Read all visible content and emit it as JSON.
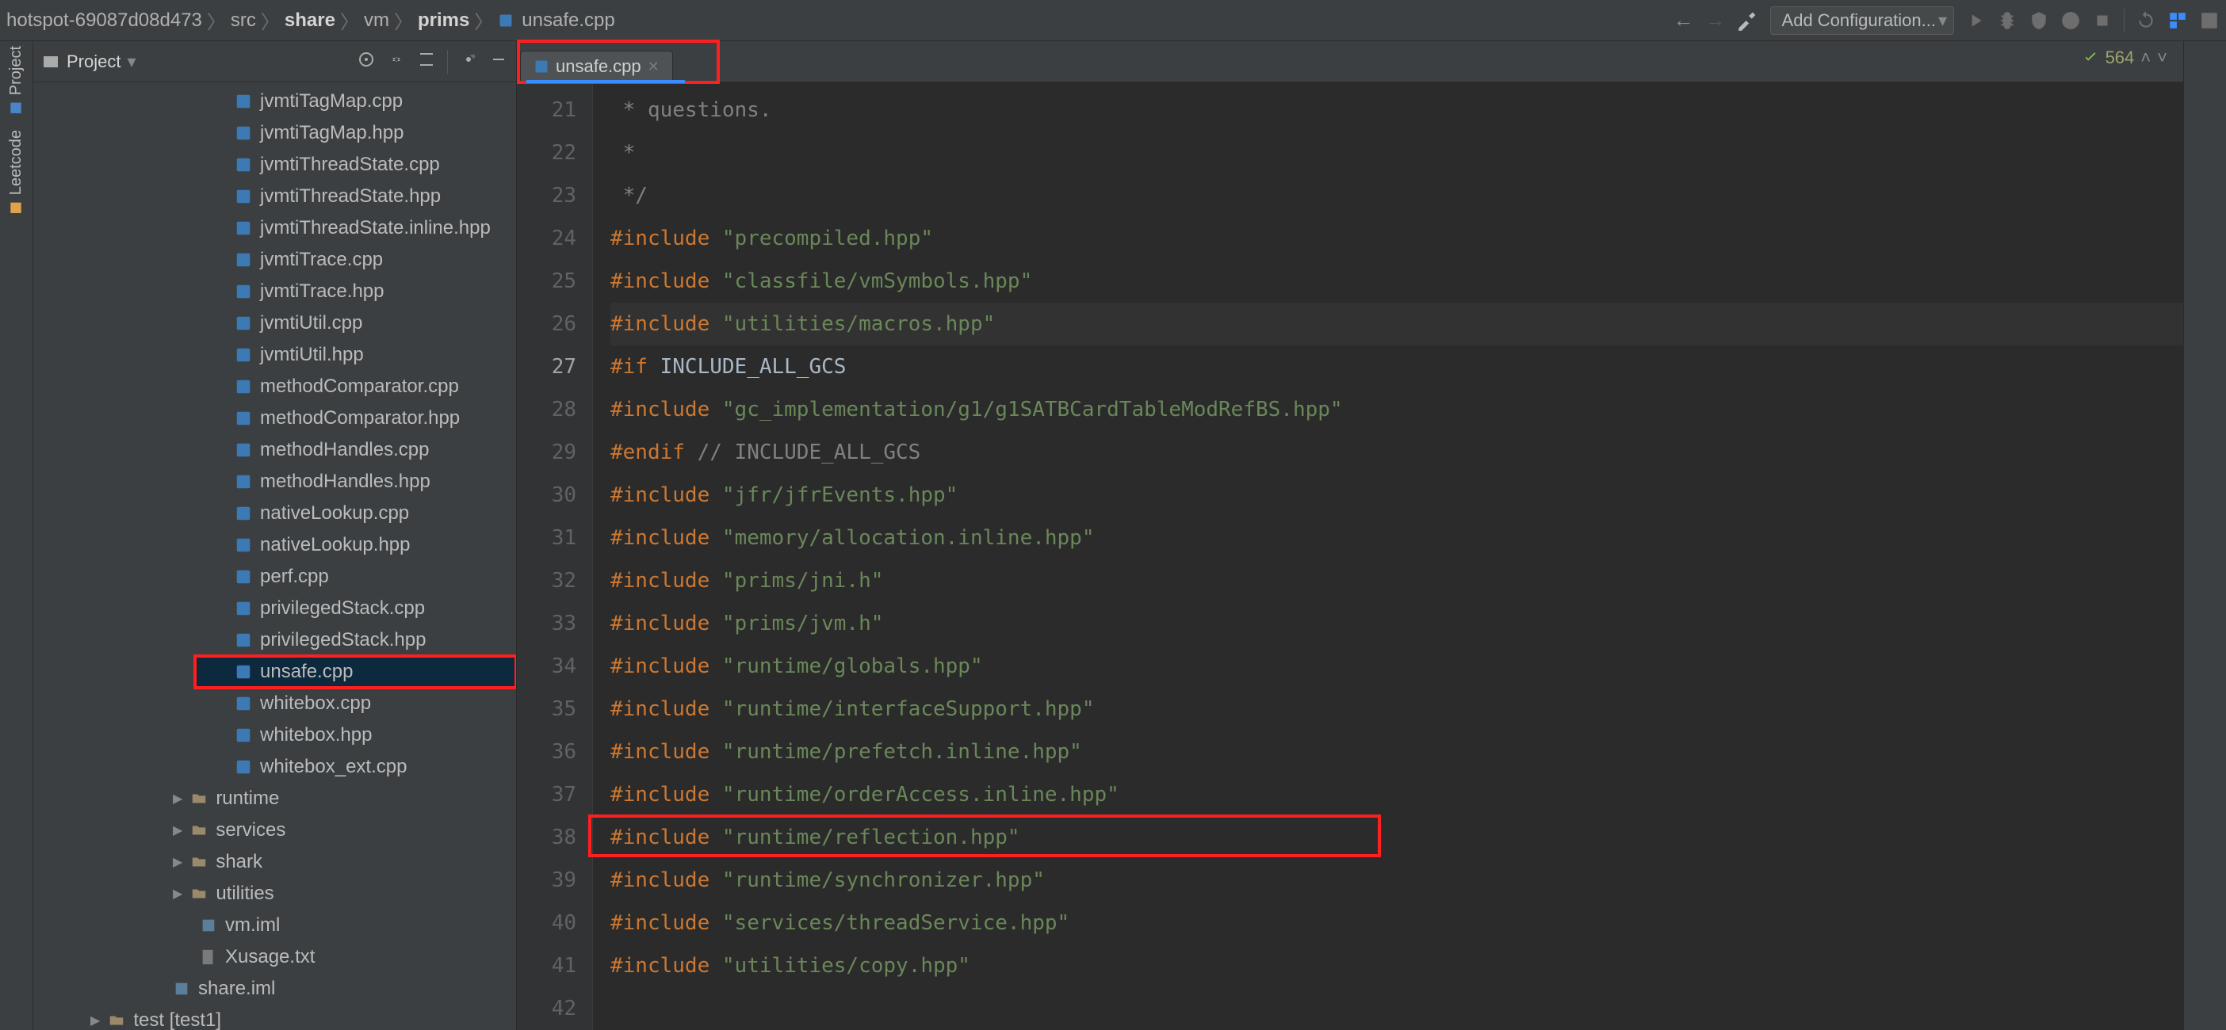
{
  "breadcrumb": {
    "segments": [
      "hotspot-69087d08d473",
      "src",
      "share",
      "vm",
      "prims",
      "unsafe.cpp"
    ],
    "bold_indices": [
      2,
      4
    ]
  },
  "toolbar": {
    "add_config_label": "Add Configuration..."
  },
  "leftrail": {
    "items": [
      "Project",
      "Leetcode"
    ]
  },
  "project_panel": {
    "title": "Project",
    "tree": [
      {
        "t": "file",
        "label": "jvmtiTagMap.cpp"
      },
      {
        "t": "file",
        "label": "jvmtiTagMap.hpp"
      },
      {
        "t": "file",
        "label": "jvmtiThreadState.cpp"
      },
      {
        "t": "file",
        "label": "jvmtiThreadState.hpp"
      },
      {
        "t": "file",
        "label": "jvmtiThreadState.inline.hpp"
      },
      {
        "t": "file",
        "label": "jvmtiTrace.cpp"
      },
      {
        "t": "file",
        "label": "jvmtiTrace.hpp"
      },
      {
        "t": "file",
        "label": "jvmtiUtil.cpp"
      },
      {
        "t": "file",
        "label": "jvmtiUtil.hpp"
      },
      {
        "t": "file",
        "label": "methodComparator.cpp"
      },
      {
        "t": "file",
        "label": "methodComparator.hpp"
      },
      {
        "t": "file",
        "label": "methodHandles.cpp"
      },
      {
        "t": "file",
        "label": "methodHandles.hpp"
      },
      {
        "t": "file",
        "label": "nativeLookup.cpp"
      },
      {
        "t": "file",
        "label": "nativeLookup.hpp"
      },
      {
        "t": "file",
        "label": "perf.cpp"
      },
      {
        "t": "file",
        "label": "privilegedStack.cpp"
      },
      {
        "t": "file",
        "label": "privilegedStack.hpp"
      },
      {
        "t": "file",
        "label": "unsafe.cpp",
        "selected": true,
        "highlighted": true
      },
      {
        "t": "file",
        "label": "whitebox.cpp"
      },
      {
        "t": "file",
        "label": "whitebox.hpp"
      },
      {
        "t": "file",
        "label": "whitebox_ext.cpp"
      },
      {
        "t": "folder0",
        "label": "runtime",
        "chev": "▶"
      },
      {
        "t": "folder0",
        "label": "services",
        "chev": "▶"
      },
      {
        "t": "folder0",
        "label": "shark",
        "chev": "▶"
      },
      {
        "t": "folder0",
        "label": "utilities",
        "chev": "▶"
      },
      {
        "t": "iml",
        "label": "vm.iml",
        "cls": "folder1"
      },
      {
        "t": "txt",
        "label": "Xusage.txt",
        "cls": "folder1"
      },
      {
        "t": "iml",
        "label": "share.iml",
        "cls": "folder0"
      },
      {
        "t": "folder-root",
        "label": "test [test1]",
        "chev": "▶"
      }
    ]
  },
  "tabs": [
    {
      "label": "unsafe.cpp",
      "active": true
    }
  ],
  "editor_status": {
    "problems": "564"
  },
  "code": {
    "first_line": 21,
    "lines": [
      [
        [
          "c-comment",
          " * questions."
        ]
      ],
      [
        [
          "c-comment",
          " *"
        ]
      ],
      [
        [
          "c-comment",
          " */"
        ]
      ],
      [
        [
          "",
          ""
        ]
      ],
      [
        [
          "c-keyword",
          "#include "
        ],
        [
          "c-string",
          "\"precompiled.hpp\""
        ]
      ],
      [
        [
          "c-keyword",
          "#include "
        ],
        [
          "c-string",
          "\"classfile/vmSymbols.hpp\""
        ]
      ],
      [
        [
          "c-keyword",
          "#include "
        ],
        [
          "c-string",
          "\"utilities/macros.hpp\""
        ]
      ],
      [
        [
          "c-keyword",
          "#if "
        ],
        [
          "c-ident",
          "INCLUDE_ALL_GCS"
        ]
      ],
      [
        [
          "c-keyword",
          "#include "
        ],
        [
          "c-string",
          "\"gc_implementation/g1/g1SATBCardTableModRefBS.hpp\""
        ]
      ],
      [
        [
          "c-keyword",
          "#endif "
        ],
        [
          "c-comment",
          "// INCLUDE_ALL_GCS"
        ]
      ],
      [
        [
          "c-keyword",
          "#include "
        ],
        [
          "c-string",
          "\"jfr/jfrEvents.hpp\""
        ]
      ],
      [
        [
          "c-keyword",
          "#include "
        ],
        [
          "c-string",
          "\"memory/allocation.inline.hpp\""
        ]
      ],
      [
        [
          "c-keyword",
          "#include "
        ],
        [
          "c-string",
          "\"prims/jni.h\""
        ]
      ],
      [
        [
          "c-keyword",
          "#include "
        ],
        [
          "c-string",
          "\"prims/jvm.h\""
        ]
      ],
      [
        [
          "c-keyword",
          "#include "
        ],
        [
          "c-string",
          "\"runtime/globals.hpp\""
        ]
      ],
      [
        [
          "c-keyword",
          "#include "
        ],
        [
          "c-string",
          "\"runtime/interfaceSupport.hpp\""
        ]
      ],
      [
        [
          "c-keyword",
          "#include "
        ],
        [
          "c-string",
          "\"runtime/prefetch.inline.hpp\""
        ]
      ],
      [
        [
          "c-keyword",
          "#include "
        ],
        [
          "c-string",
          "\"runtime/orderAccess.inline.hpp\""
        ]
      ],
      [
        [
          "c-keyword",
          "#include "
        ],
        [
          "c-string",
          "\"runtime/reflection.hpp\""
        ]
      ],
      [
        [
          "c-keyword",
          "#include "
        ],
        [
          "c-string",
          "\"runtime/synchronizer.hpp\""
        ]
      ],
      [
        [
          "c-keyword",
          "#include "
        ],
        [
          "c-string",
          "\"services/threadService.hpp\""
        ]
      ],
      [
        [
          "c-keyword",
          "#include "
        ],
        [
          "c-string",
          "\"utilities/copy.hpp\""
        ]
      ]
    ],
    "current_line_index": 6,
    "red_box_line_index": 17
  }
}
